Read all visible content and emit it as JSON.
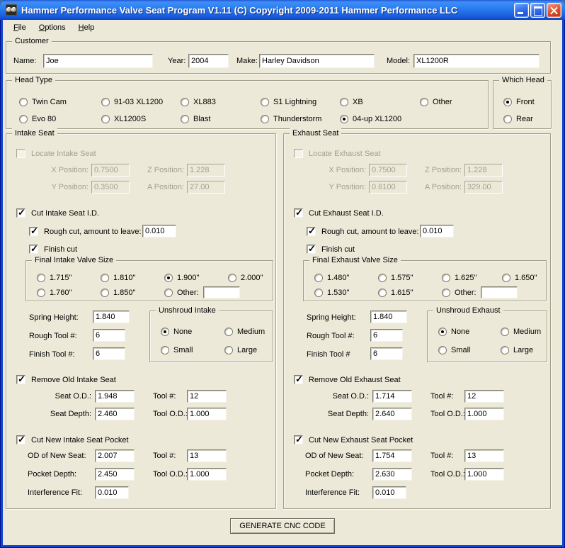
{
  "window": {
    "title": "Hammer Performance Valve Seat Program V1.11 (C) Copyright 2009-2011 Hammer Performance LLC"
  },
  "menu": {
    "items": [
      {
        "key": "F",
        "rest": "ile"
      },
      {
        "key": "O",
        "rest": "ptions"
      },
      {
        "key": "H",
        "rest": "elp"
      }
    ]
  },
  "customer": {
    "legend": "Customer",
    "name_label": "Name:",
    "name_value": "Joe",
    "year_label": "Year:",
    "year_value": "2004",
    "make_label": "Make:",
    "make_value": "Harley Davidson",
    "model_label": "Model:",
    "model_value": "XL1200R"
  },
  "head_type": {
    "legend": "Head Type",
    "row1": [
      {
        "label": "Twin Cam",
        "checked": false
      },
      {
        "label": "91-03 XL1200",
        "checked": false
      },
      {
        "label": "XL883",
        "checked": false
      },
      {
        "label": "S1 Lightning",
        "checked": false
      },
      {
        "label": "XB",
        "checked": false
      },
      {
        "label": "Other",
        "checked": false
      }
    ],
    "row2": [
      {
        "label": "Evo 80",
        "checked": false
      },
      {
        "label": "XL1200S",
        "checked": false
      },
      {
        "label": "Blast",
        "checked": false
      },
      {
        "label": "Thunderstorm",
        "checked": false
      },
      {
        "label": "04-up XL1200",
        "checked": true
      }
    ]
  },
  "which_head": {
    "legend": "Which Head",
    "options": [
      {
        "label": "Front",
        "checked": true
      },
      {
        "label": "Rear",
        "checked": false
      }
    ]
  },
  "intake": {
    "legend": "Intake Seat",
    "locate": {
      "label": "Locate Intake Seat",
      "checked": false,
      "x_label": "X Position:",
      "x_value": "0.7500",
      "z_label": "Z Position:",
      "z_value": "1.228",
      "y_label": "Y Position:",
      "y_value": "0.3500",
      "a_label": "A Position:",
      "a_value": "27.00"
    },
    "cut_id": {
      "label": "Cut Intake Seat I.D.",
      "checked": true,
      "rough": {
        "label": "Rough cut, amount to leave:",
        "checked": true,
        "value": "0.010"
      },
      "finish": {
        "label": "Finish cut",
        "checked": true
      }
    },
    "valve_size": {
      "legend": "Final Intake Valve Size",
      "row1": [
        {
          "label": "1.715\"",
          "checked": false
        },
        {
          "label": "1.810\"",
          "checked": false
        },
        {
          "label": "1.900\"",
          "checked": true
        },
        {
          "label": "2.000\"",
          "checked": false
        }
      ],
      "row2": [
        {
          "label": "1.760\"",
          "checked": false
        },
        {
          "label": "1.850\"",
          "checked": false
        }
      ],
      "other": {
        "label": "Other:",
        "checked": false,
        "value": ""
      }
    },
    "spring_height": {
      "label": "Spring Height:",
      "value": "1.840"
    },
    "rough_tool": {
      "label": "Rough Tool #:",
      "value": "6"
    },
    "finish_tool": {
      "label": "Finish Tool #:",
      "value": "6"
    },
    "unshroud": {
      "legend": "Unshroud Intake",
      "options": [
        {
          "label": "None",
          "checked": true
        },
        {
          "label": "Medium",
          "checked": false
        },
        {
          "label": "Small",
          "checked": false
        },
        {
          "label": "Large",
          "checked": false
        }
      ]
    },
    "remove_old": {
      "label": "Remove Old Intake Seat",
      "checked": true,
      "seat_od": {
        "label": "Seat O.D.:",
        "value": "1.948"
      },
      "tool": {
        "label": "Tool #:",
        "value": "12"
      },
      "seat_depth": {
        "label": "Seat Depth:",
        "value": "2.460"
      },
      "tool_od": {
        "label": "Tool O.D.:",
        "value": "1.000"
      }
    },
    "cut_new": {
      "label": "Cut New Intake Seat Pocket",
      "checked": true,
      "od_new": {
        "label": "OD of New Seat:",
        "value": "2.007"
      },
      "tool": {
        "label": "Tool #:",
        "value": "13"
      },
      "pocket_depth": {
        "label": "Pocket Depth:",
        "value": "2.450"
      },
      "tool_od": {
        "label": "Tool O.D.:",
        "value": "1.000"
      },
      "interference": {
        "label": "Interference Fit:",
        "value": "0.010"
      }
    }
  },
  "exhaust": {
    "legend": "Exhaust Seat",
    "locate": {
      "label": "Locate Exhaust Seat",
      "checked": false,
      "x_label": "X Position:",
      "x_value": "0.7500",
      "z_label": "Z Position:",
      "z_value": "1.228",
      "y_label": "Y Position:",
      "y_value": "0.6100",
      "a_label": "A Position:",
      "a_value": "329.00"
    },
    "cut_id": {
      "label": "Cut Exhaust Seat I.D.",
      "checked": true,
      "rough": {
        "label": "Rough cut, amount to leave:",
        "checked": true,
        "value": "0.010"
      },
      "finish": {
        "label": "Finish cut",
        "checked": true
      }
    },
    "valve_size": {
      "legend": "Final Exhaust Valve Size",
      "row1": [
        {
          "label": "1.480\"",
          "checked": false
        },
        {
          "label": "1.575\"",
          "checked": false
        },
        {
          "label": "1.625\"",
          "checked": false
        },
        {
          "label": "1.650\"",
          "checked": false
        }
      ],
      "row2": [
        {
          "label": "1.530\"",
          "checked": false
        },
        {
          "label": "1.615\"",
          "checked": false
        }
      ],
      "other": {
        "label": "Other:",
        "checked": false,
        "value": ""
      }
    },
    "spring_height": {
      "label": "Spring Height:",
      "value": "1.840"
    },
    "rough_tool": {
      "label": "Rough Tool #:",
      "value": "6"
    },
    "finish_tool": {
      "label": "Finish Tool #",
      "value": "6"
    },
    "unshroud": {
      "legend": "Unshroud Exhaust",
      "options": [
        {
          "label": "None",
          "checked": true
        },
        {
          "label": "Medium",
          "checked": false
        },
        {
          "label": "Small",
          "checked": false
        },
        {
          "label": "Large",
          "checked": false
        }
      ]
    },
    "remove_old": {
      "label": "Remove Old Exhaust Seat",
      "checked": true,
      "seat_od": {
        "label": "Seat O.D.:",
        "value": "1.714"
      },
      "tool": {
        "label": "Tool #:",
        "value": "12"
      },
      "seat_depth": {
        "label": "Seat Depth:",
        "value": "2.640"
      },
      "tool_od": {
        "label": "Tool O.D.:",
        "value": "1.000"
      }
    },
    "cut_new": {
      "label": "Cut New Exhaust Seat Pocket",
      "checked": true,
      "od_new": {
        "label": "OD of New Seat:",
        "value": "1.754"
      },
      "tool": {
        "label": "Tool #:",
        "value": "13"
      },
      "pocket_depth": {
        "label": "Pocket Depth:",
        "value": "2.630"
      },
      "tool_od": {
        "label": "Tool O.D.:",
        "value": "1.000"
      },
      "interference": {
        "label": "Interference Fit:",
        "value": "0.010"
      }
    }
  },
  "footer": {
    "generate_button": "GENERATE CNC CODE"
  },
  "colors": {
    "client_bg": "#ECE9D8",
    "titlebar_blue": "#2A7AF0",
    "window_border": "#1144D0",
    "close_red": "#D8452C",
    "disabled_text": "#A3A093"
  }
}
